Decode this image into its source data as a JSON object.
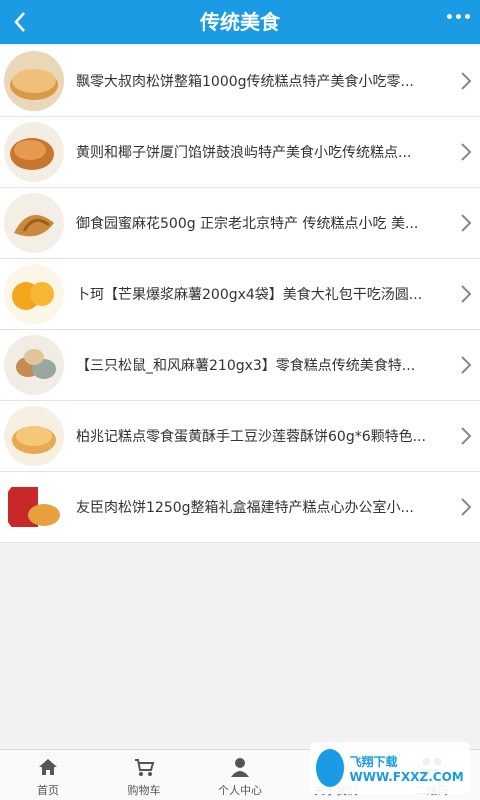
{
  "header": {
    "title": "传统美食",
    "watermark": "飞翔下载 WWW.FXXZ.COM"
  },
  "items": [
    {
      "label": "飘零大叔肉松饼整箱1000g传统糕点特产美食小吃零..."
    },
    {
      "label": "黄则和椰子饼厦门馅饼鼓浪屿特产美食小吃传统糕点..."
    },
    {
      "label": "御食园蜜麻花500g 正宗老北京特产 传统糕点小吃 美..."
    },
    {
      "label": "卜珂【芒果爆浆麻薯200gx4袋】美食大礼包干吃汤圆..."
    },
    {
      "label": "【三只松鼠_和风麻薯210gx3】零食糕点传统美食特..."
    },
    {
      "label": "柏兆记糕点零食蛋黄酥手工豆沙莲蓉酥饼60g*6颗特色..."
    },
    {
      "label": "友臣肉松饼1250g整箱礼盒福建特产糕点心办公室小..."
    }
  ],
  "tabs": [
    {
      "label": "首页",
      "icon": "home-icon"
    },
    {
      "label": "购物车",
      "icon": "cart-icon"
    },
    {
      "label": "个人中心",
      "icon": "user-icon"
    },
    {
      "label": "关于我们",
      "icon": "info-icon"
    },
    {
      "label": "二维码",
      "icon": "qrcode-icon"
    }
  ],
  "logo_badge": {
    "text": "飞翔下载 WWW.FXXZ.COM"
  },
  "colors": {
    "header": "#1a9be3",
    "background": "#f2f2f2"
  }
}
